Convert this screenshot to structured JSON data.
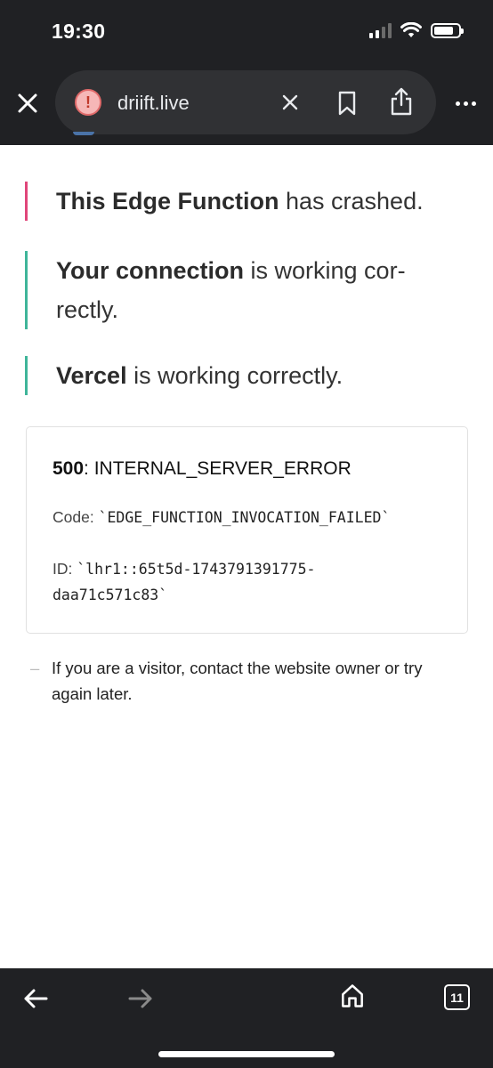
{
  "status_bar": {
    "time": "19:30"
  },
  "browser": {
    "url": "driift.live",
    "tab_count": "11",
    "icons": {
      "close_tab": "close-icon",
      "site_warning": "warning-icon",
      "clear_url": "close-icon",
      "bookmark": "bookmark-icon",
      "share": "share-icon",
      "more": "more-icon",
      "back": "arrow-left-icon",
      "forward": "arrow-right-icon",
      "home": "home-icon"
    }
  },
  "page": {
    "crashed": {
      "bold": "This Edge Function",
      "rest": " has crashed.",
      "accent_color": "#e0467a"
    },
    "connection": {
      "bold": "Your connection",
      "rest": " is working cor-rectly.",
      "accent_color": "#3fb59a"
    },
    "vercel": {
      "bold": "Vercel",
      "rest": " is working correctly.",
      "accent_color": "#3fb59a"
    },
    "error": {
      "status_code": "500",
      "status_text": ": INTERNAL_SERVER_ERROR",
      "code_label": "Code: ",
      "code_value": "`EDGE_FUNCTION_INVOCATION_FAILED`",
      "id_label": "ID: ",
      "id_value": "`lhr1::65t5d-1743791391775-daa71c571c83`"
    },
    "visitor_note": {
      "dash": "–",
      "text": "If you are a visitor, contact the website owner or try again later."
    }
  }
}
